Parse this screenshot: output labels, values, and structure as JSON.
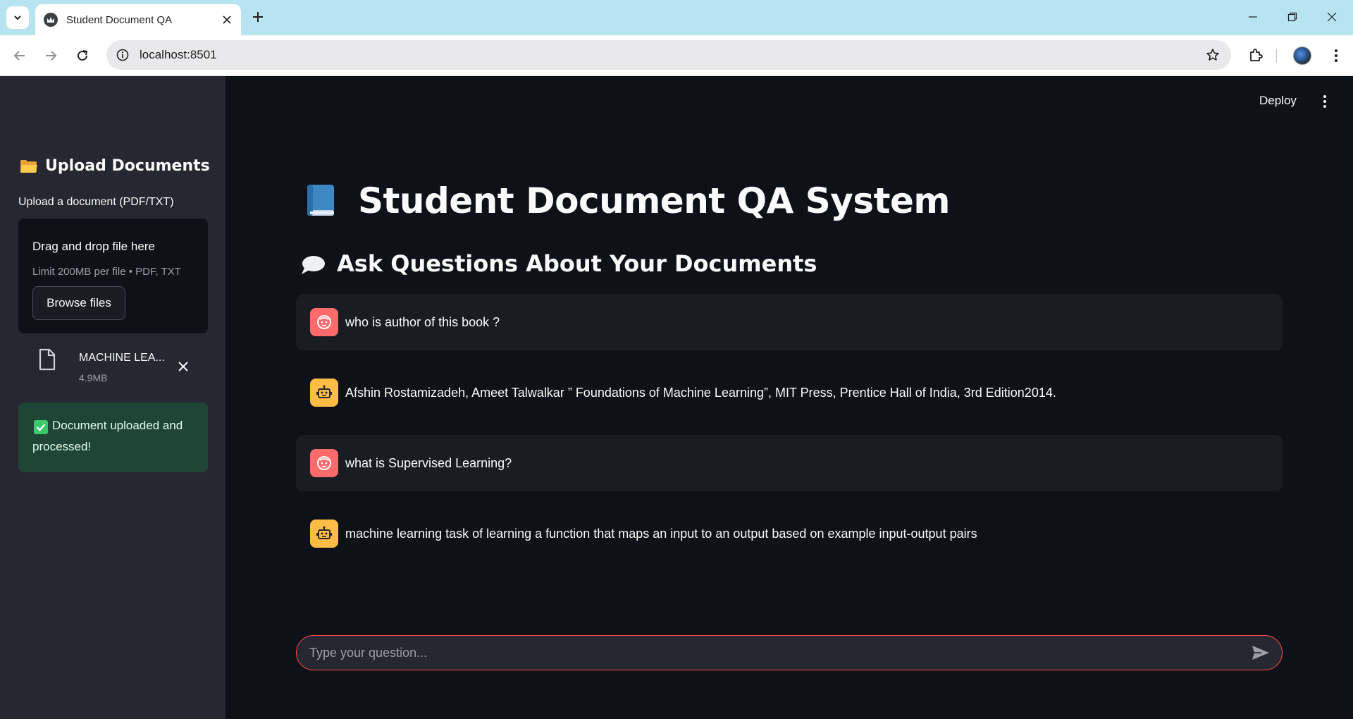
{
  "browser": {
    "tab_title": "Student Document QA",
    "url": "localhost:8501"
  },
  "sidebar": {
    "title": "Upload Documents",
    "uploader_label": "Upload a document (PDF/TXT)",
    "dropzone_title": "Drag and drop file here",
    "dropzone_limit": "Limit 200MB per file • PDF, TXT",
    "browse_label": "Browse files",
    "file_name": "MACHINE LEA...",
    "file_size": "4.9MB",
    "success_message": "Document uploaded and processed!"
  },
  "header": {
    "deploy_label": "Deploy"
  },
  "main": {
    "title": "Student Document QA System",
    "subheader": "Ask Questions About Your Documents",
    "messages": [
      {
        "role": "user",
        "text": "who is author of this book ?"
      },
      {
        "role": "assistant",
        "text": "Afshin Rostamizadeh, Ameet Talwalkar ” Foundations of Machine Learning”, MIT Press, Prentice Hall of India, 3rd Edition2014."
      },
      {
        "role": "user",
        "text": "what is Supervised Learning?"
      },
      {
        "role": "assistant",
        "text": "machine learning task of learning a function that maps an input to an output based on example input-output pairs"
      }
    ],
    "input_placeholder": "Type your question..."
  },
  "icons": {
    "folder": "folder-icon",
    "book": "blue-book-icon",
    "speech": "speech-bubble-icon",
    "user_avatar": "user-face-icon",
    "assistant_avatar": "robot-icon"
  },
  "colors": {
    "accent": "#ff4b4b",
    "user_avatar": "#ff6b6b",
    "assistant_avatar": "#ffbd45",
    "success_bg": "#1f4536"
  }
}
